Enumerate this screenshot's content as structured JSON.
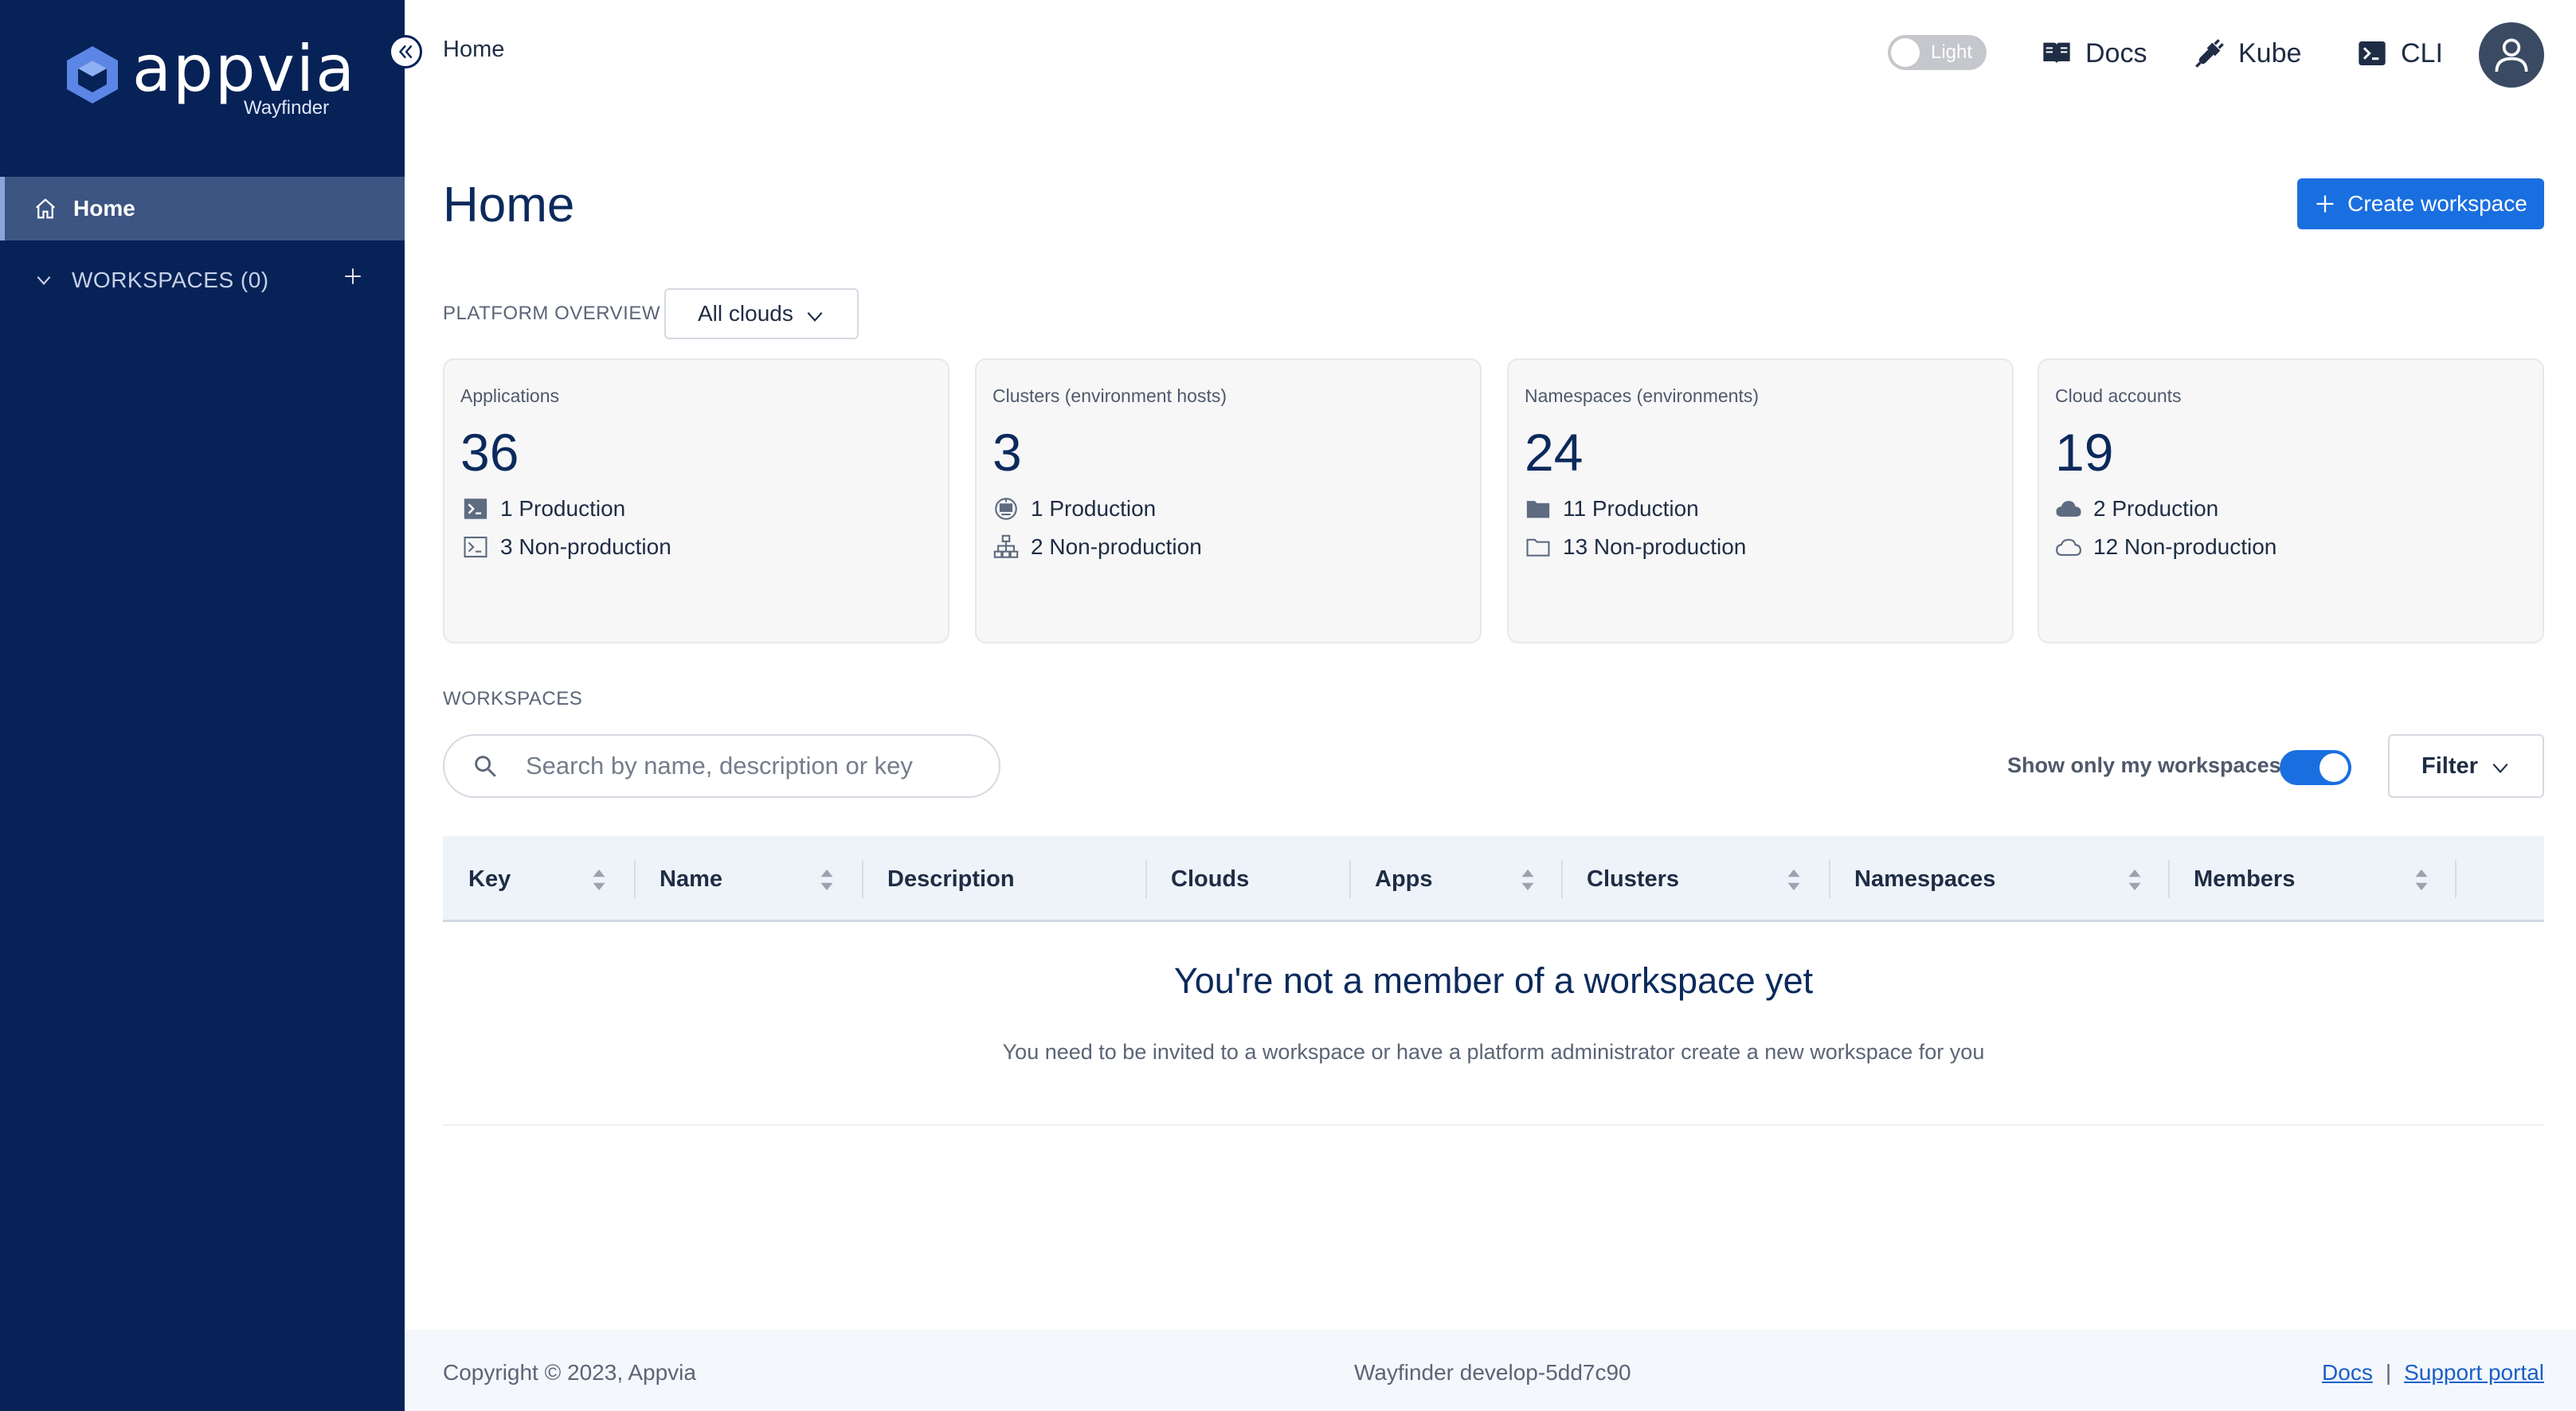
{
  "brand": {
    "name": "appvia",
    "product": "Wayfinder"
  },
  "sidebar": {
    "home_label": "Home",
    "workspaces_label": "WORKSPACES (0)"
  },
  "topbar": {
    "breadcrumb": "Home",
    "theme_toggle_label": "Light",
    "docs_label": "Docs",
    "kube_label": "Kube",
    "cli_label": "CLI"
  },
  "page": {
    "title": "Home",
    "create_button_label": "Create workspace"
  },
  "overview": {
    "section_label": "PLATFORM OVERVIEW",
    "cloud_filter_value": "All clouds",
    "cards": [
      {
        "title": "Applications",
        "total": "36",
        "production": "1 Production",
        "non_production": "3 Non-production"
      },
      {
        "title": "Clusters (environment hosts)",
        "total": "3",
        "production": "1 Production",
        "non_production": "2 Non-production"
      },
      {
        "title": "Namespaces (environments)",
        "total": "24",
        "production": "11 Production",
        "non_production": "13 Non-production"
      },
      {
        "title": "Cloud accounts",
        "total": "19",
        "production": "2 Production",
        "non_production": "12 Non-production"
      }
    ]
  },
  "workspaces": {
    "section_label": "WORKSPACES",
    "search_placeholder": "Search by name, description or key",
    "show_mine_label": "Show only my workspaces",
    "show_mine_enabled": true,
    "filter_label": "Filter",
    "columns": [
      "Key",
      "Name",
      "Description",
      "Clouds",
      "Apps",
      "Clusters",
      "Namespaces",
      "Members"
    ],
    "empty_title": "You're not a member of a workspace yet",
    "empty_subtitle": "You need to be invited to a workspace or have a platform administrator create a new workspace for you"
  },
  "footer": {
    "copyright": "Copyright © 2023, Appvia",
    "version": "Wayfinder develop-5dd7c90",
    "docs_link": "Docs",
    "separator": "|",
    "support_link": "Support portal"
  },
  "colors": {
    "sidebar_bg": "#062257",
    "accent": "#1a6fe0",
    "heading": "#0b2a5c"
  }
}
